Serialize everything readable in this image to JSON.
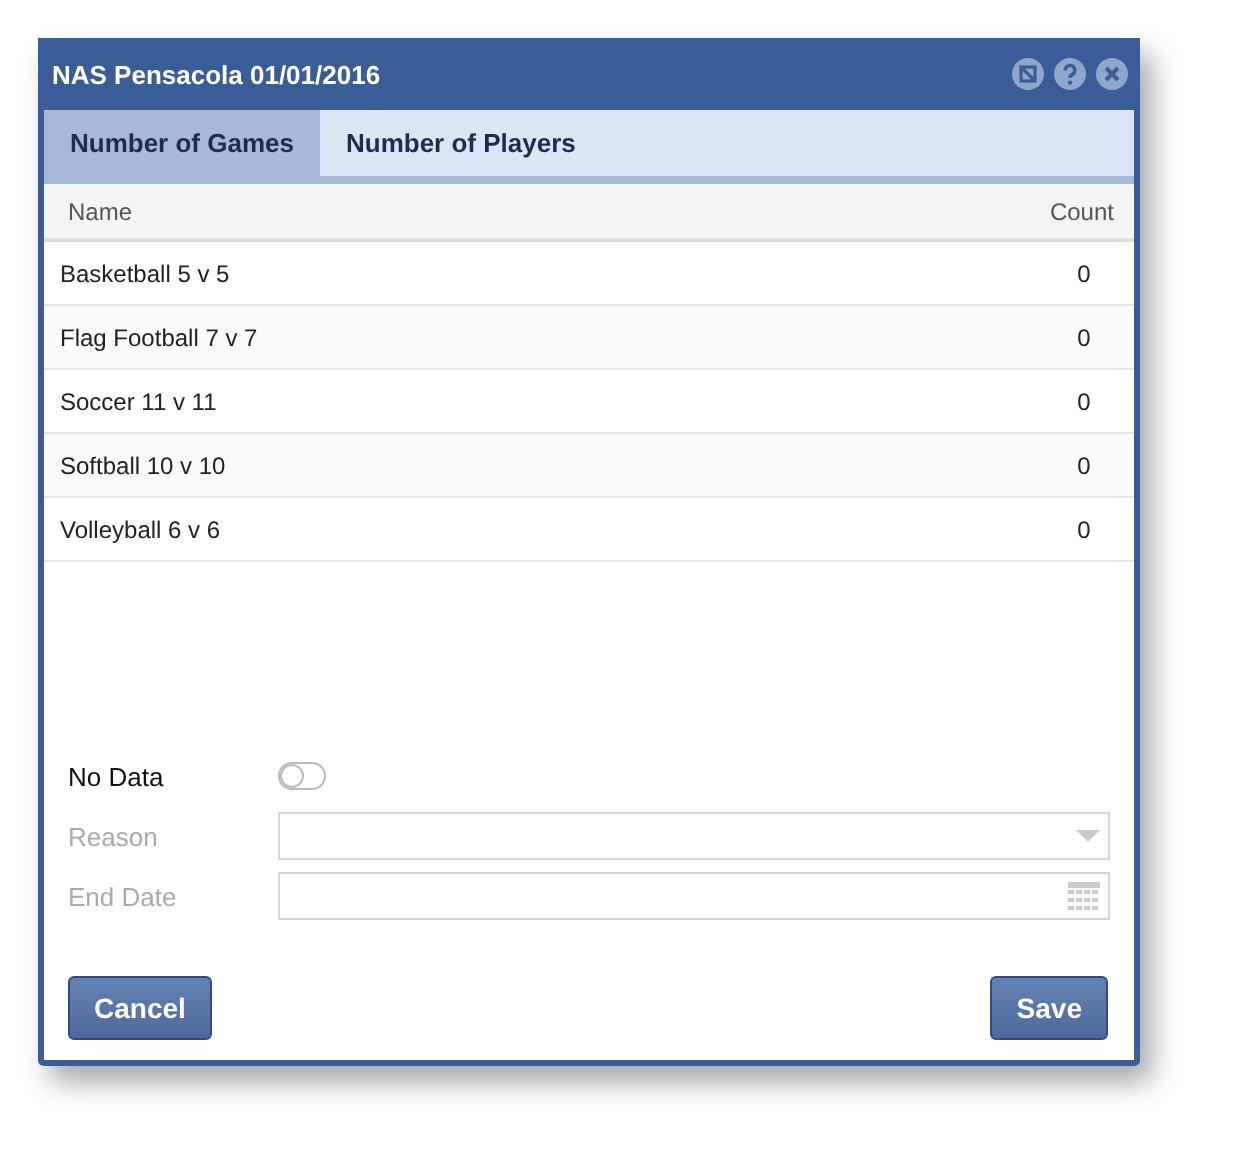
{
  "window": {
    "title": "NAS Pensacola 01/01/2016"
  },
  "tabs": [
    {
      "label": "Number of Games",
      "selected": true
    },
    {
      "label": "Number of Players",
      "selected": false
    }
  ],
  "table": {
    "columns": [
      "Name",
      "Count"
    ],
    "rows": [
      [
        "Basketball 5 v 5",
        "0"
      ],
      [
        "Flag Football 7 v 7",
        "0"
      ],
      [
        "Soccer 11 v 11",
        "0"
      ],
      [
        "Softball 10 v 10",
        "0"
      ],
      [
        "Volleyball 6 v 6",
        "0"
      ]
    ]
  },
  "no_data": {
    "label": "No Data",
    "on": false
  },
  "fields": [
    {
      "label": "Reason",
      "kind": "dropdown",
      "disabled": true
    },
    {
      "label": "End Date",
      "kind": "date",
      "disabled": true
    }
  ],
  "buttons": [
    "Cancel",
    "Save"
  ]
}
